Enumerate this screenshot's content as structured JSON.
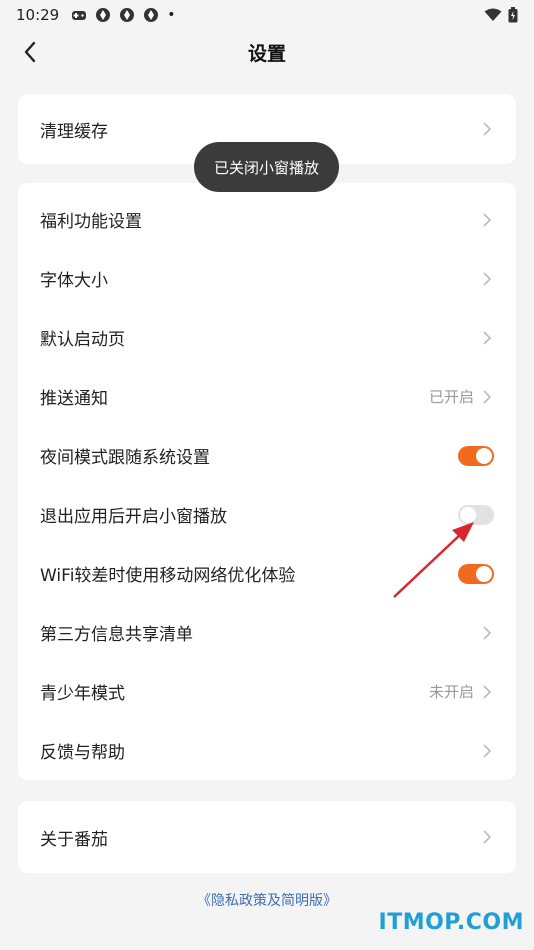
{
  "status_bar": {
    "time": "10:29",
    "dot": "•"
  },
  "nav": {
    "title": "设置"
  },
  "toast": {
    "text": "已关闭小窗播放"
  },
  "card1": {
    "items": [
      {
        "label": "清理缓存"
      }
    ]
  },
  "card2": {
    "items": [
      {
        "label": "福利功能设置"
      },
      {
        "label": "字体大小"
      },
      {
        "label": "默认启动页"
      },
      {
        "label": "推送通知",
        "value": "已开启"
      },
      {
        "label": "夜间模式跟随系统设置",
        "toggle": true
      },
      {
        "label": "退出应用后开启小窗播放",
        "toggle": false
      },
      {
        "label": "WiFi较差时使用移动网络优化体验",
        "toggle": true
      },
      {
        "label": "第三方信息共享清单"
      },
      {
        "label": "青少年模式",
        "value": "未开启"
      },
      {
        "label": "反馈与帮助"
      }
    ]
  },
  "card3": {
    "items": [
      {
        "label": "关于番茄"
      }
    ]
  },
  "footer": {
    "privacy_link": "《隐私政策及简明版》",
    "watermark": "ITMOP.COM"
  },
  "colors": {
    "accent": "#f26a1f",
    "toggle_off": "#e2e2e2",
    "link": "#3f6fb5",
    "annotation_arrow": "#d9262c"
  }
}
